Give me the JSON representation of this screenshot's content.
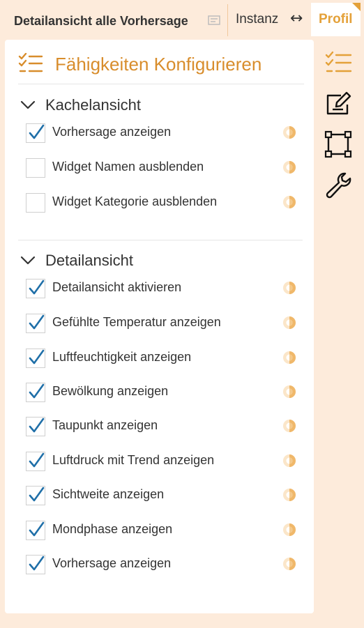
{
  "header": {
    "title": "Detailansicht alle Vorhersage",
    "instanz": "Instanz",
    "arrow": "↔",
    "profil": "Profil"
  },
  "panel": {
    "title": "Fähigkeiten Konfigurieren",
    "sections": [
      {
        "label": "Kachelansicht",
        "items": [
          {
            "label": "Vorhersage anzeigen",
            "checked": true
          },
          {
            "label": "Widget Namen ausblenden",
            "checked": false
          },
          {
            "label": "Widget Kategorie ausblenden",
            "checked": false
          }
        ]
      },
      {
        "label": "Detailansicht",
        "items": [
          {
            "label": "Detailansicht aktivieren",
            "checked": true
          },
          {
            "label": "Gefühlte Temperatur anzeigen",
            "checked": true
          },
          {
            "label": "Luftfeuchtigkeit anzeigen",
            "checked": true
          },
          {
            "label": "Bewölkung anzeigen",
            "checked": true
          },
          {
            "label": "Taupunkt anzeigen",
            "checked": true
          },
          {
            "label": "Luftdruck mit Trend anzeigen",
            "checked": true
          },
          {
            "label": "Sichtweite anzeigen",
            "checked": true
          },
          {
            "label": "Mondphase anzeigen",
            "checked": true
          },
          {
            "label": "Vorhersage anzeigen",
            "checked": true
          }
        ]
      }
    ]
  },
  "sidebar": {
    "icons": [
      "checklist-icon",
      "edit-icon",
      "transform-icon",
      "wrench-icon"
    ]
  },
  "colors": {
    "accent": "#e4a139",
    "background": "#fdebdb",
    "check": "#1f6fa8"
  }
}
